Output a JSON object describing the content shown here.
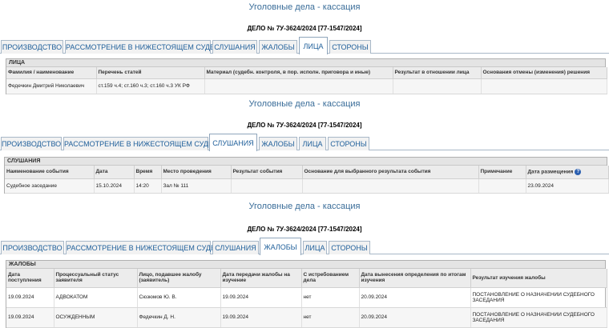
{
  "page_title": "Уголовные дела - кассация",
  "case_number": "ДЕЛО № 7У-3624/2024 [77-1547/2024]",
  "tabs": {
    "proceedings": "ПРОИЗВОДСТВО",
    "lower_court": "РАССМОТРЕНИЕ В НИЖЕСТОЯЩЕМ СУДЕ",
    "hearings": "СЛУШАНИЯ",
    "complaints": "ЖАЛОБЫ",
    "persons": "ЛИЦА",
    "parties": "СТОРОНЫ"
  },
  "persons_section": {
    "title": "ЛИЦА",
    "columns": [
      "Фамилия / наименование",
      "Перечень статей",
      "Материал (судебн. контроля, в пор. исполн. приговора и иные)",
      "Результат в отношении лица",
      "Основания отмены (изменения) решения"
    ],
    "rows": [
      [
        "Федечкин Дмитрий Николаевич",
        "ст.159 ч.4; ст.160 ч.3; ст.160 ч.3 УК РФ",
        "",
        "",
        ""
      ]
    ]
  },
  "hearings_section": {
    "title": "СЛУШАНИЯ",
    "columns": [
      "Наименование события",
      "Дата",
      "Время",
      "Место проведения",
      "Результат события",
      "Основание для выбранного результата события",
      "Примечание",
      "Дата размещения"
    ],
    "help_icon": "?",
    "rows": [
      [
        "Судебное заседание",
        "15.10.2024",
        "14:20",
        "Зал № 111",
        "",
        "",
        "",
        "23.09.2024"
      ]
    ]
  },
  "complaints_section": {
    "title": "ЖАЛОБЫ",
    "columns": [
      "Дата поступления",
      "Процессуальный статус заявителя",
      "Лицо, подавшее жалобу (заявитель)",
      "Дата передачи жалобы на изучение",
      "С истребованием дела",
      "Дата вынесения определения по итогам изучения",
      "Результат изучения жалобы"
    ],
    "rows": [
      [
        "19.09.2024",
        "АДВОКАТОМ",
        "Сюзюмов Ю. В.",
        "19.09.2024",
        "нет",
        "20.09.2024",
        "ПОСТАНОВЛЕНИЕ О НАЗНАЧЕНИИ СУДЕБНОГО ЗАСЕДАНИЯ"
      ],
      [
        "19.09.2024",
        "ОСУЖДЕННЫМ",
        "Федечкин Д. Н.",
        "19.09.2024",
        "нет",
        "20.09.2024",
        "ПОСТАНОВЛЕНИЕ О НАЗНАЧЕНИИ СУДЕБНОГО ЗАСЕДАНИЯ"
      ]
    ]
  }
}
